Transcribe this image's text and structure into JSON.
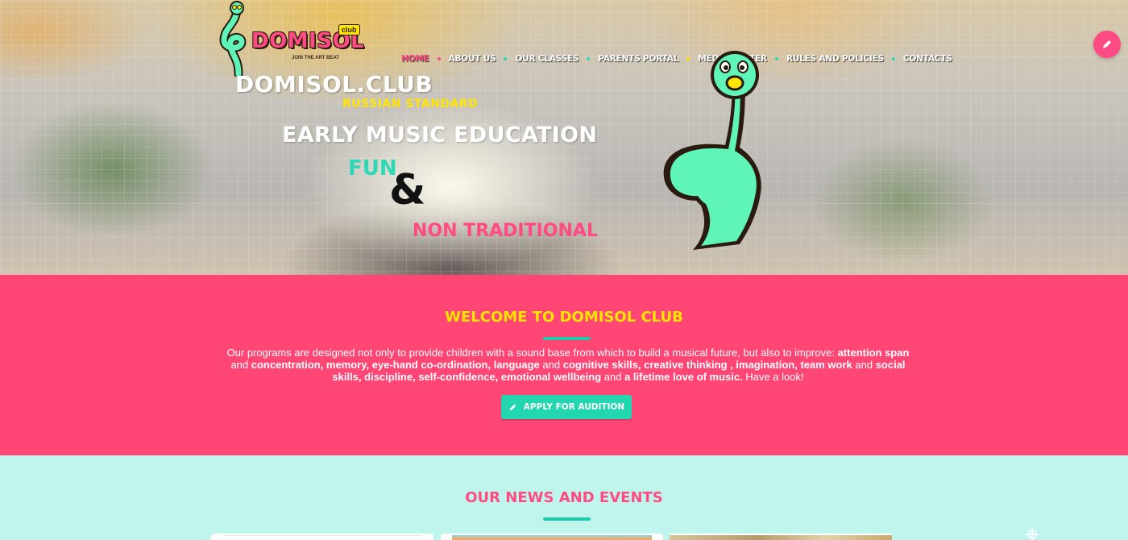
{
  "brand": {
    "logo_word": "DOMISOL",
    "logo_badge": "club",
    "logo_tagline": "JOIN THE ART BEAT"
  },
  "nav": {
    "items": [
      {
        "label": "HOME",
        "active": true
      },
      {
        "label": "ABOUT US",
        "active": false
      },
      {
        "label": "OUR CLASSES",
        "active": false
      },
      {
        "label": "PARENTS PORTAL",
        "active": false
      },
      {
        "label": "MEDIA CENTER",
        "active": false
      },
      {
        "label": "RULES AND POLICIES",
        "active": false
      },
      {
        "label": "CONTACTS",
        "active": false
      }
    ],
    "dot_colors": [
      "#ff4a83",
      "#2dd9b5",
      "#2dd9b5",
      "#ffe500",
      "#2dd9b5",
      "#2dd9b5"
    ]
  },
  "hero": {
    "title": "DOMISOL.CLUB",
    "subtitle": "RUSSIAN  STANDARD",
    "headline": "EARLY MUSIC EDUCATION",
    "word_fun": "FUN",
    "ampersand": "&",
    "word_non": "NON TRADITIONAL"
  },
  "welcome": {
    "heading": "WELCOME TO DOMISOL CLUB",
    "paragraph": [
      {
        "text": "Our programs are designed not only to provide children with a sound base from which to build a musical future, but also to improve: ",
        "bold": false
      },
      {
        "text": "attention span",
        "bold": true
      },
      {
        "text": " and ",
        "bold": false
      },
      {
        "text": "concentration, memory, eye-hand co-ordination, language",
        "bold": true
      },
      {
        "text": " and ",
        "bold": false
      },
      {
        "text": "cognitive skills, creative thinking , imagination, team work",
        "bold": true
      },
      {
        "text": " and ",
        "bold": false
      },
      {
        "text": "social skills, discipline, self-confidence, emotional wellbeing",
        "bold": true
      },
      {
        "text": " and ",
        "bold": false
      },
      {
        "text": "a lifetime love of music.",
        "bold": true
      },
      {
        "text": " Have a look!",
        "bold": false
      }
    ],
    "apply_button": "APPLY FOR AUDITION"
  },
  "news": {
    "heading": "OUR NEWS AND EVENTS"
  },
  "colors": {
    "pink": "#ff4675",
    "teal": "#22d6b0",
    "yellow": "#ffe500",
    "mint_bg": "#bff5ec"
  },
  "icons": {
    "edit_fab": "pencil-icon",
    "apply_button": "pencil-icon",
    "scroll": "crosshair-icon"
  }
}
